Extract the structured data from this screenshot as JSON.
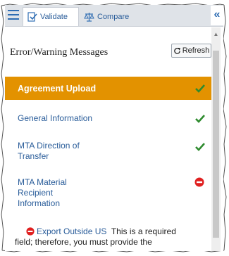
{
  "tabs": {
    "validate_label": "Validate",
    "compare_label": "Compare"
  },
  "header": {
    "title": "Error/Warning Messages",
    "refresh_label": "Refresh"
  },
  "items": [
    {
      "label": "Agreement Upload",
      "status": "ok"
    },
    {
      "label": "General Information",
      "status": "ok"
    },
    {
      "label_line1": "MTA Direction of",
      "label_line2": "Transfer",
      "status": "ok"
    },
    {
      "label_line1": "MTA Material",
      "label_line2": "Recipient",
      "label_line3": "Information",
      "status": "error"
    }
  ],
  "detail": {
    "link_text": "Export Outside US",
    "message_line1": "This is a required",
    "message_line2": "field; therefore, you must provide the"
  },
  "colors": {
    "accent": "#e39200",
    "link": "#2a5d9a",
    "ok": "#2e8b2e",
    "error": "#e02020"
  },
  "icons": {
    "menu": "hamburger-icon",
    "validate": "validate-icon",
    "compare": "compare-icon",
    "collapse": "double-chevron-left-icon",
    "refresh": "refresh-icon",
    "ok": "check-icon",
    "error": "no-entry-icon"
  }
}
